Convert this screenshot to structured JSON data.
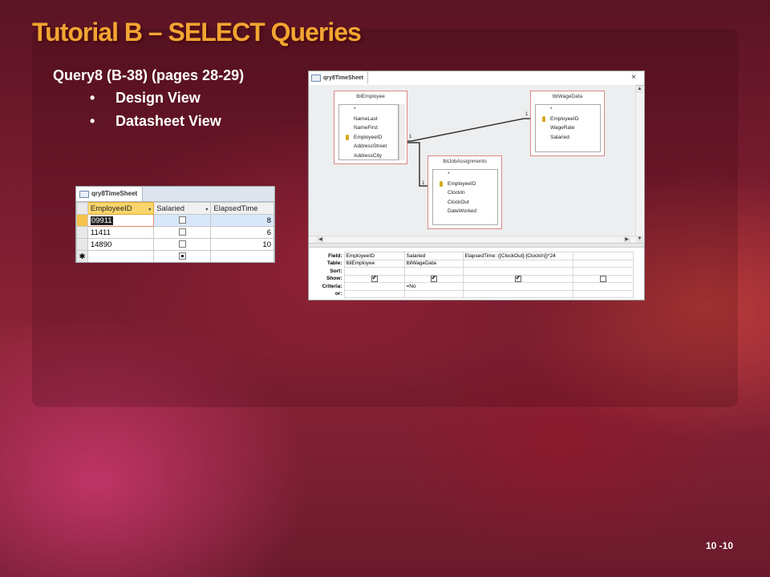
{
  "slide": {
    "title": "Tutorial B – SELECT Queries",
    "subtitle": "Query8 (B-38) (pages 28-29)",
    "bullets": [
      "Design View",
      "Datasheet View"
    ],
    "bullet_glyph": "•",
    "page_number": "10 -10"
  },
  "datasheet": {
    "tab_title": "qry8TimeSheet",
    "columns": [
      "EmployeeID",
      "Salaried",
      "ElapsedTime"
    ],
    "rows": [
      {
        "employee_id": "09911",
        "salaried": false,
        "elapsed": "8"
      },
      {
        "employee_id": "11411",
        "salaried": false,
        "elapsed": "6"
      },
      {
        "employee_id": "14890",
        "salaried": false,
        "elapsed": "10"
      }
    ],
    "new_row_marker": "✱"
  },
  "design_view": {
    "tab_title": "qry8TimeSheet",
    "close_glyph": "×",
    "tables": {
      "employee": {
        "name": "tblEmployee",
        "fields": [
          "*",
          "NameLast",
          "NameFirst",
          "EmployeeID",
          "AddressStreet",
          "AddressCity"
        ]
      },
      "wage": {
        "name": "tblWageData",
        "fields": [
          "*",
          "EmployeeID",
          "WageRate",
          "Salaried"
        ]
      },
      "jobs": {
        "name": "tblJobAssignments",
        "fields": [
          "*",
          "EmployeeID",
          "ClockIn",
          "ClockOut",
          "DateWorked"
        ]
      }
    },
    "relationship_labels": {
      "one_a": "1",
      "one_b": "1",
      "one_c": "1"
    },
    "grid": {
      "row_labels": [
        "Field:",
        "Table:",
        "Sort:",
        "Show:",
        "Criteria:",
        "or:"
      ],
      "columns": [
        {
          "field": "EmployeeID",
          "table": "tblEmployee",
          "sort": "",
          "show": true,
          "criteria": "",
          "or": ""
        },
        {
          "field": "Salaried",
          "table": "tblWageData",
          "sort": "",
          "show": true,
          "criteria": "=No",
          "or": ""
        },
        {
          "field": "ElapsedTime: ([ClockOut]-[ClockIn])*24",
          "table": "",
          "sort": "",
          "show": true,
          "criteria": "",
          "or": ""
        },
        {
          "field": "",
          "table": "",
          "sort": "",
          "show": false,
          "criteria": "",
          "or": ""
        }
      ]
    }
  }
}
